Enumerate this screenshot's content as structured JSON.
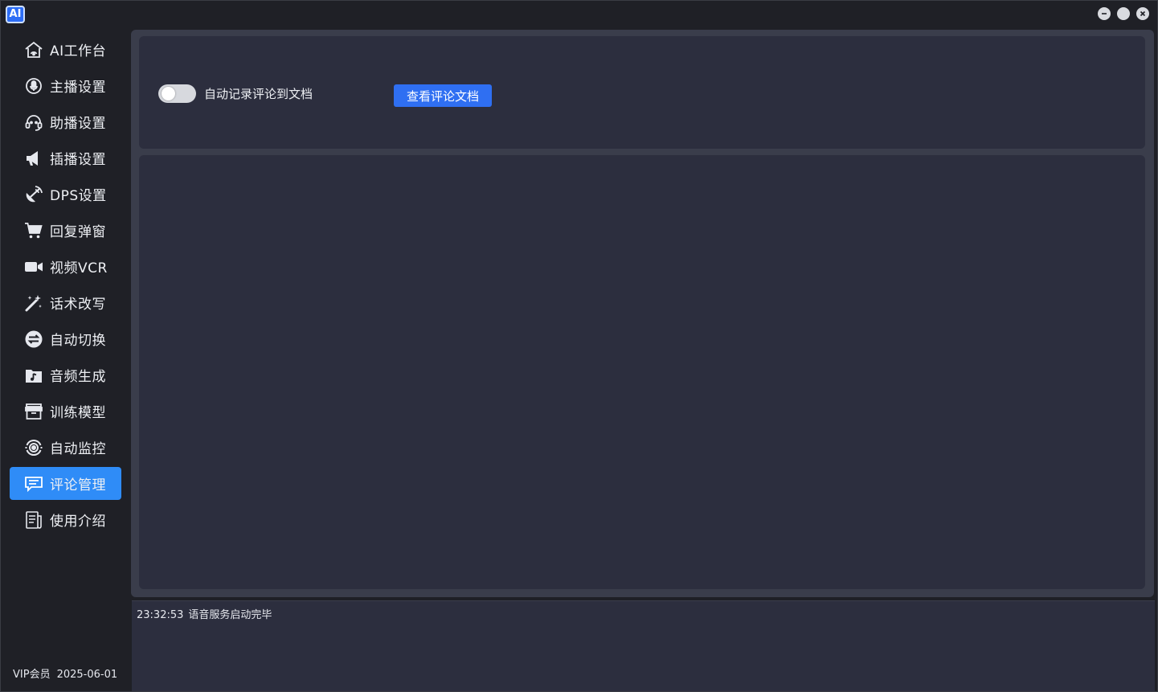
{
  "app": {
    "logo_text": "AI"
  },
  "window_controls": {
    "icons": [
      "minimize-icon",
      "maximize-icon",
      "close-icon"
    ]
  },
  "sidebar": {
    "items": [
      {
        "label": "AI工作台",
        "icon": "home-icon",
        "active": false
      },
      {
        "label": "主播设置",
        "icon": "microphone-icon",
        "active": false
      },
      {
        "label": "助播设置",
        "icon": "headset-icon",
        "active": false
      },
      {
        "label": "插播设置",
        "icon": "megaphone-icon",
        "active": false
      },
      {
        "label": "DPS设置",
        "icon": "satellite-icon",
        "active": false
      },
      {
        "label": "回复弹窗",
        "icon": "cart-icon",
        "active": false
      },
      {
        "label": "视频VCR",
        "icon": "video-camera-icon",
        "active": false
      },
      {
        "label": "话术改写",
        "icon": "magic-wand-icon",
        "active": false
      },
      {
        "label": "自动切换",
        "icon": "switch-icon",
        "active": false
      },
      {
        "label": "音频生成",
        "icon": "music-folder-icon",
        "active": false
      },
      {
        "label": "训练模型",
        "icon": "archive-box-icon",
        "active": false
      },
      {
        "label": "自动监控",
        "icon": "monitor-target-icon",
        "active": false
      },
      {
        "label": "评论管理",
        "icon": "comment-icon",
        "active": true
      },
      {
        "label": "使用介绍",
        "icon": "document-icon",
        "active": false
      }
    ],
    "footer": {
      "membership": "VIP会员",
      "expiry": "2025-06-01"
    }
  },
  "comment_panel": {
    "toggle_label": "自动记录评论到文档",
    "toggle_on": false,
    "view_button_label": "查看评论文档"
  },
  "log": {
    "time": "23:32:53",
    "message": "语音服务启动完毕"
  },
  "colors": {
    "accent": "#2f8cf7",
    "button": "#2f6ff2",
    "panel": "#2c2e3e",
    "background": "#1f2026"
  }
}
